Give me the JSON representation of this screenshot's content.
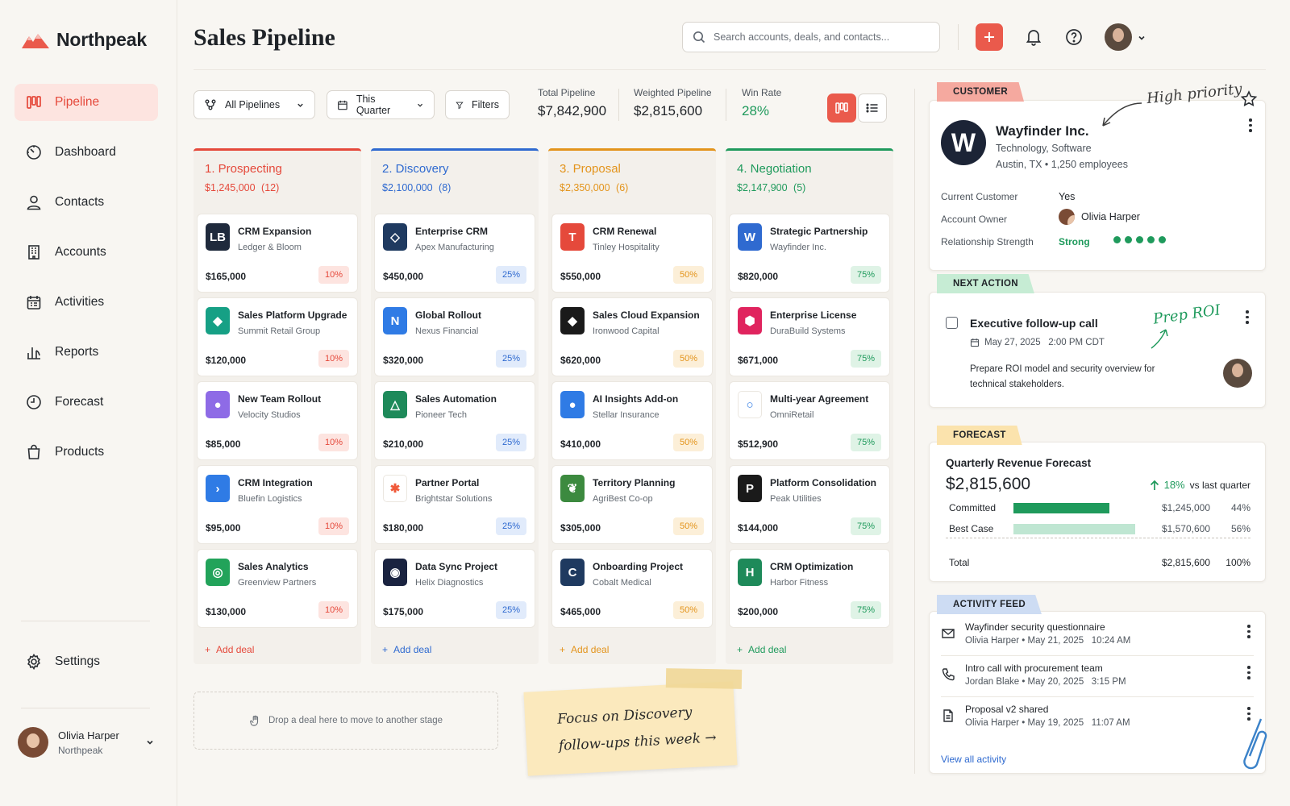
{
  "app": {
    "name": "Northpeak"
  },
  "sidebar": {
    "items": [
      {
        "label": "Pipeline",
        "icon": "pipeline-icon"
      },
      {
        "label": "Dashboard",
        "icon": "dashboard-icon"
      },
      {
        "label": "Contacts",
        "icon": "contacts-icon"
      },
      {
        "label": "Accounts",
        "icon": "accounts-icon"
      },
      {
        "label": "Activities",
        "icon": "activities-icon"
      },
      {
        "label": "Reports",
        "icon": "reports-icon"
      },
      {
        "label": "Forecast",
        "icon": "forecast-icon"
      },
      {
        "label": "Products",
        "icon": "products-icon"
      }
    ],
    "settings_label": "Settings",
    "user": {
      "name": "Olivia Harper",
      "org": "Northpeak"
    }
  },
  "header": {
    "title": "Sales Pipeline",
    "search_placeholder": "Search accounts, deals, and contacts..."
  },
  "toolbar": {
    "pipelines_label": "All Pipelines",
    "period_label": "This Quarter",
    "filters_label": "Filters",
    "stats": [
      {
        "label": "Total Pipeline",
        "value": "$7,842,900"
      },
      {
        "label": "Weighted Pipeline",
        "value": "$2,815,600"
      },
      {
        "label": "Win Rate",
        "value": "28%"
      }
    ]
  },
  "columns": [
    {
      "title": "1. Prospecting",
      "total": "$1,245,000",
      "count": "(12)",
      "color": "#e5493b",
      "badge_bg": "#fde4e0",
      "add_label": "Add deal",
      "deals": [
        {
          "title": "CRM Expansion",
          "company": "Ledger & Bloom",
          "amount": "$165,000",
          "prob": "10%",
          "logo": "LB",
          "logo_color": "#1f2a3c"
        },
        {
          "title": "Sales Platform Upgrade",
          "company": "Summit Retail Group",
          "amount": "$120,000",
          "prob": "10%",
          "logo": "◆",
          "logo_color": "#16a085"
        },
        {
          "title": "New Team Rollout",
          "company": "Velocity Studios",
          "amount": "$85,000",
          "prob": "10%",
          "logo": "●",
          "logo_color": "#8e6be6"
        },
        {
          "title": "CRM Integration",
          "company": "Bluefin Logistics",
          "amount": "$95,000",
          "prob": "10%",
          "logo": "›",
          "logo_color": "#2f7be5"
        },
        {
          "title": "Sales Analytics",
          "company": "Greenview Partners",
          "amount": "$130,000",
          "prob": "10%",
          "logo": "◎",
          "logo_color": "#22a35a"
        }
      ]
    },
    {
      "title": "2. Discovery",
      "total": "$2,100,000",
      "count": "(8)",
      "color": "#2f6ad0",
      "badge_bg": "#e1ebfb",
      "add_label": "Add deal",
      "deals": [
        {
          "title": "Enterprise CRM",
          "company": "Apex Manufacturing",
          "amount": "$450,000",
          "prob": "25%",
          "logo": "◇",
          "logo_color": "#1f3a60"
        },
        {
          "title": "Global Rollout",
          "company": "Nexus Financial",
          "amount": "$320,000",
          "prob": "25%",
          "logo": "N",
          "logo_color": "#2f7be5"
        },
        {
          "title": "Sales Automation",
          "company": "Pioneer Tech",
          "amount": "$210,000",
          "prob": "25%",
          "logo": "△",
          "logo_color": "#1e8a5a"
        },
        {
          "title": "Partner Portal",
          "company": "Brightstar Solutions",
          "amount": "$180,000",
          "prob": "25%",
          "logo": "✱",
          "logo_color": "#ffffff"
        },
        {
          "title": "Data Sync Project",
          "company": "Helix Diagnostics",
          "amount": "$175,000",
          "prob": "25%",
          "logo": "◉",
          "logo_color": "#1a2340"
        }
      ]
    },
    {
      "title": "3. Proposal",
      "total": "$2,350,000",
      "count": "(6)",
      "color": "#e3941c",
      "badge_bg": "#fcefd8",
      "add_label": "Add deal",
      "deals": [
        {
          "title": "CRM Renewal",
          "company": "Tinley Hospitality",
          "amount": "$550,000",
          "prob": "50%",
          "logo": "T",
          "logo_color": "#e5493b"
        },
        {
          "title": "Sales Cloud Expansion",
          "company": "Ironwood Capital",
          "amount": "$620,000",
          "prob": "50%",
          "logo": "◆",
          "logo_color": "#1a1a1a"
        },
        {
          "title": "AI Insights Add-on",
          "company": "Stellar Insurance",
          "amount": "$410,000",
          "prob": "50%",
          "logo": "●",
          "logo_color": "#2f7be5"
        },
        {
          "title": "Territory Planning",
          "company": "AgriBest Co-op",
          "amount": "$305,000",
          "prob": "50%",
          "logo": "❦",
          "logo_color": "#3c8a3f"
        },
        {
          "title": "Onboarding Project",
          "company": "Cobalt Medical",
          "amount": "$465,000",
          "prob": "50%",
          "logo": "C",
          "logo_color": "#1f3a60"
        }
      ]
    },
    {
      "title": "4. Negotiation",
      "total": "$2,147,900",
      "count": "(5)",
      "color": "#1f9a5c",
      "badge_bg": "#dff3e6",
      "add_label": "Add deal",
      "deals": [
        {
          "title": "Strategic Partnership",
          "company": "Wayfinder Inc.",
          "amount": "$820,000",
          "prob": "75%",
          "logo": "W",
          "logo_color": "#2f6ad0"
        },
        {
          "title": "Enterprise License",
          "company": "DuraBuild Systems",
          "amount": "$671,000",
          "prob": "75%",
          "logo": "⬢",
          "logo_color": "#e0245e"
        },
        {
          "title": "Multi-year Agreement",
          "company": "OmniRetail",
          "amount": "$512,900",
          "prob": "75%",
          "logo": "○",
          "logo_color": "#ffffff"
        },
        {
          "title": "Platform Consolidation",
          "company": "Peak Utilities",
          "amount": "$144,000",
          "prob": "75%",
          "logo": "P",
          "logo_color": "#1a1a1a"
        },
        {
          "title": "CRM Optimization",
          "company": "Harbor Fitness",
          "amount": "$200,000",
          "prob": "75%",
          "logo": "H",
          "logo_color": "#1e8a5a"
        }
      ]
    }
  ],
  "board": {
    "drop_hint": "Drop a deal here to move to another stage",
    "sticky_note": "Focus on Discovery follow-ups this week →"
  },
  "customer": {
    "tag": "CUSTOMER",
    "note": "High priority",
    "avatar_letter": "W",
    "name": "Wayfinder Inc.",
    "industry": "Technology, Software",
    "location": "Austin, TX • 1,250 employees",
    "current_label": "Current Customer",
    "current_value": "Yes",
    "owner_label": "Account Owner",
    "owner_value": "Olivia Harper",
    "strength_label": "Relationship Strength",
    "strength_value": "Strong",
    "strength_level": 5
  },
  "next_action": {
    "tag": "NEXT ACTION",
    "note": "Prep ROI",
    "title": "Executive follow-up call",
    "datetime": "May 27, 2025   2:00 PM CDT",
    "description": "Prepare ROI model and security overview for technical stakeholders."
  },
  "forecast": {
    "tag": "FORECAST",
    "title": "Quarterly Revenue Forecast",
    "value": "$2,815,600",
    "change": "18%",
    "change_note": "vs last quarter",
    "rows": [
      {
        "label": "Committed",
        "amount": "$1,245,000",
        "pct": "44%",
        "fraction": 0.44,
        "color": "#1f9a5c"
      },
      {
        "label": "Best Case",
        "amount": "$1,570,600",
        "pct": "56%",
        "fraction": 0.56,
        "color": "#bfe6d2"
      }
    ],
    "total_label": "Total",
    "total_amount": "$2,815,600",
    "total_pct": "100%"
  },
  "activity": {
    "tag": "ACTIVITY FEED",
    "items": [
      {
        "title": "Wayfinder security questionnaire",
        "meta": "Olivia Harper • May 21, 2025   10:24 AM",
        "icon": "mail-icon"
      },
      {
        "title": "Intro call with procurement team",
        "meta": "Jordan Blake • May 20, 2025   3:15 PM",
        "icon": "phone-icon"
      },
      {
        "title": "Proposal v2 shared",
        "meta": "Olivia Harper • May 19, 2025   11:07 AM",
        "icon": "document-icon"
      }
    ],
    "view_all": "View all activity"
  },
  "colors": {
    "accent": "#ea5a4c",
    "link": "#2f6ad0",
    "success": "#1f9a5c"
  }
}
